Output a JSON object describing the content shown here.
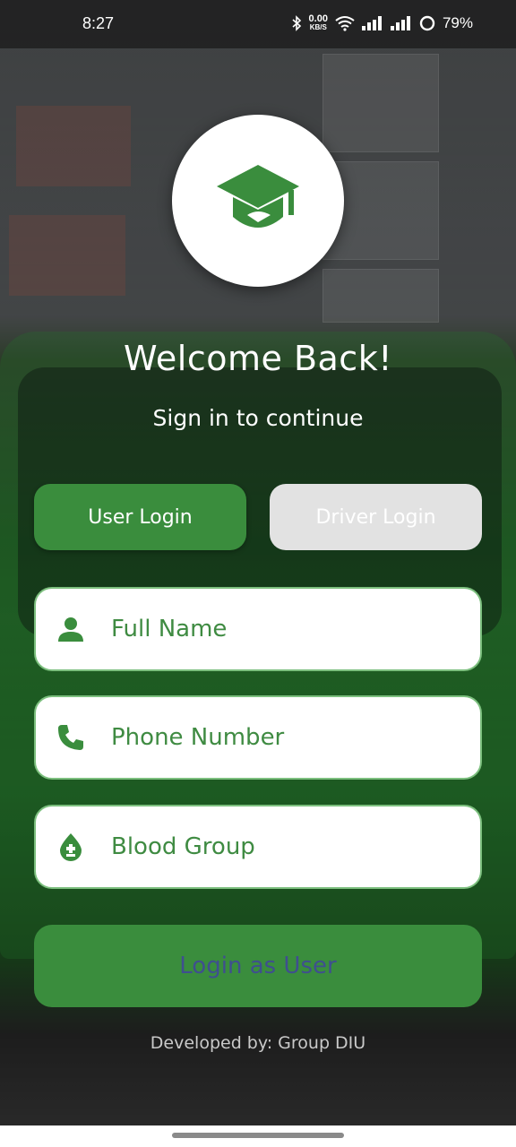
{
  "status_bar": {
    "time": "8:27",
    "net_speed_value": "0.00",
    "net_speed_unit": "KB/S",
    "battery": "79%"
  },
  "header": {
    "title": "Welcome Back!",
    "subtitle": "Sign in to continue"
  },
  "tabs": {
    "user_label": "User Login",
    "driver_label": "Driver Login",
    "active": "user"
  },
  "form": {
    "full_name_placeholder": "Full Name",
    "phone_placeholder": "Phone Number",
    "blood_group_placeholder": "Blood Group"
  },
  "login_button_label": "Login as User",
  "footer_text": "Developed by: Group DIU",
  "colors": {
    "primary_green": "#3a8d3d",
    "field_border": "#7cbf7e",
    "inactive_tab": "#e2e2e2"
  },
  "icons": {
    "logo": "graduation-cap-icon",
    "full_name": "person-icon",
    "phone": "phone-icon",
    "blood_group": "blood-drop-icon"
  }
}
